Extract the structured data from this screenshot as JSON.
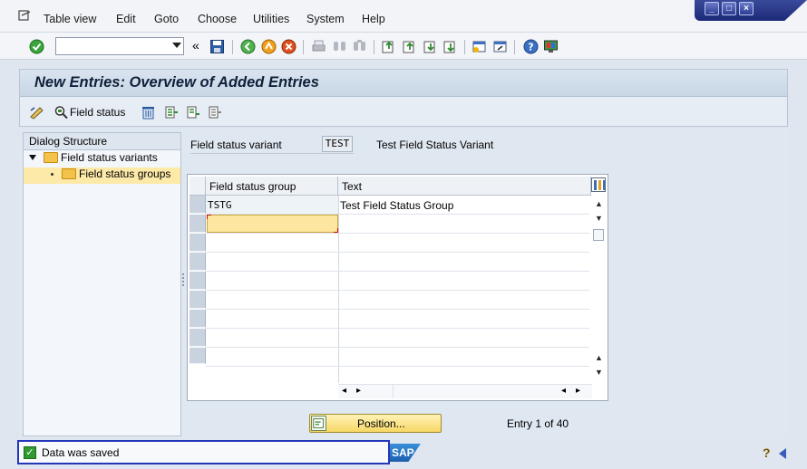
{
  "menu": {
    "items": [
      "Table view",
      "Edit",
      "Goto",
      "Choose",
      "Utilities",
      "System",
      "Help"
    ]
  },
  "toolbar": {
    "command_value": "",
    "icons": [
      "enter-icon",
      "back-arrows-icon",
      "save-icon",
      "back-icon",
      "exit-icon",
      "cancel-icon",
      "print-icon",
      "find-icon",
      "find-next-icon",
      "first-page-icon",
      "previous-page-icon",
      "next-page-icon",
      "last-page-icon",
      "new-session-icon",
      "shortcut-icon",
      "help-icon",
      "customize-layout-icon"
    ]
  },
  "page": {
    "title": "New Entries: Overview of Added Entries"
  },
  "app_toolbar": {
    "field_status_label": "Field status"
  },
  "dialog_structure": {
    "header": "Dialog Structure",
    "items": [
      {
        "label": "Field status variants"
      },
      {
        "label": "Field status groups",
        "selected": true
      }
    ]
  },
  "variant": {
    "label": "Field status variant",
    "value": "TEST",
    "description": "Test Field Status Variant"
  },
  "table": {
    "columns": [
      "Field status group",
      "Text"
    ],
    "rows": [
      {
        "group": "TSTG",
        "text": "Test Field Status Group"
      }
    ]
  },
  "position_button": {
    "label": "Position..."
  },
  "entry_counter": "Entry 1 of 40",
  "status": {
    "message": "Data was saved"
  },
  "branding": {
    "logo": "SAP"
  },
  "colors": {
    "title_bar": "#c8d6e5",
    "window_controls": "#2b3c94",
    "active_cell": "#fde6a0",
    "status_border": "#2436b9",
    "success": "#2f9a2f"
  }
}
